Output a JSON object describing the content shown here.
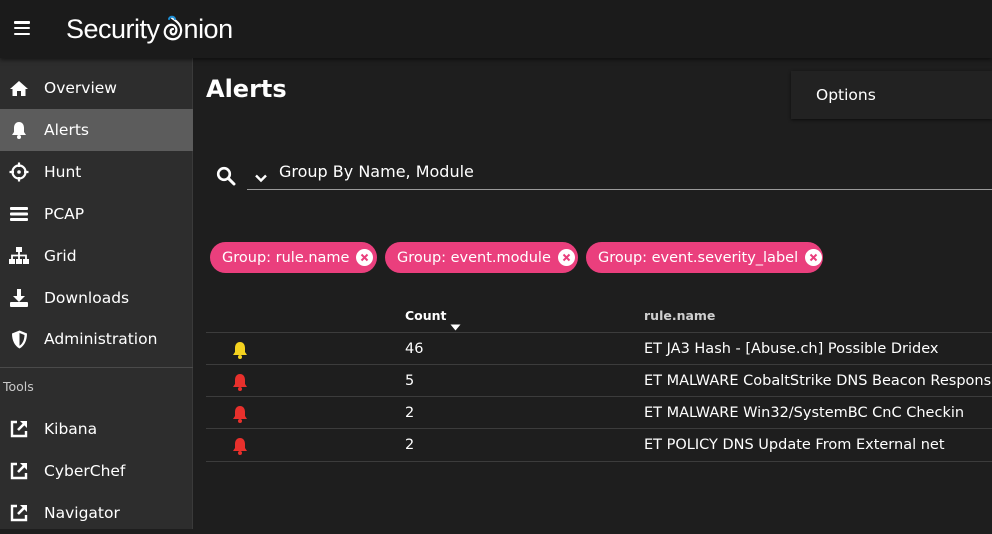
{
  "app": {
    "title_prefix": "Security",
    "title_suffix": "nion"
  },
  "sidebar": {
    "items": [
      {
        "label": "Overview",
        "icon": "home-icon"
      },
      {
        "label": "Alerts",
        "icon": "bell-icon",
        "active": true
      },
      {
        "label": "Hunt",
        "icon": "crosshair-icon"
      },
      {
        "label": "PCAP",
        "icon": "list-icon"
      },
      {
        "label": "Grid",
        "icon": "sitemap-icon"
      },
      {
        "label": "Downloads",
        "icon": "download-icon"
      },
      {
        "label": "Administration",
        "icon": "shield-icon"
      }
    ],
    "tools_heading": "Tools",
    "tools": [
      {
        "label": "Kibana",
        "icon": "external-link-icon"
      },
      {
        "label": "CyberChef",
        "icon": "external-link-icon"
      },
      {
        "label": "Navigator",
        "icon": "external-link-icon"
      }
    ]
  },
  "main": {
    "title": "Alerts",
    "options_label": "Options",
    "query": "Group By Name, Module",
    "chips": [
      "Group: rule.name",
      "Group: event.module",
      "Group: event.severity_label"
    ],
    "table": {
      "columns": [
        "Count",
        "rule.name"
      ],
      "rows": [
        {
          "severity": "medium",
          "count": "46",
          "rule": "ET JA3 Hash - [Abuse.ch] Possible Dridex"
        },
        {
          "severity": "high",
          "count": "5",
          "rule": "ET MALWARE CobaltStrike DNS Beacon Response"
        },
        {
          "severity": "high",
          "count": "2",
          "rule": "ET MALWARE Win32/SystemBC CnC Checkin"
        },
        {
          "severity": "high",
          "count": "2",
          "rule": "ET POLICY DNS Update From External net"
        }
      ]
    }
  },
  "colors": {
    "chip": "#ea3f7d",
    "severity_medium": "#f4d21f",
    "severity_high": "#e8302c",
    "active_nav": "#5c5c5c",
    "logo_accent": "#1e8fd6"
  }
}
